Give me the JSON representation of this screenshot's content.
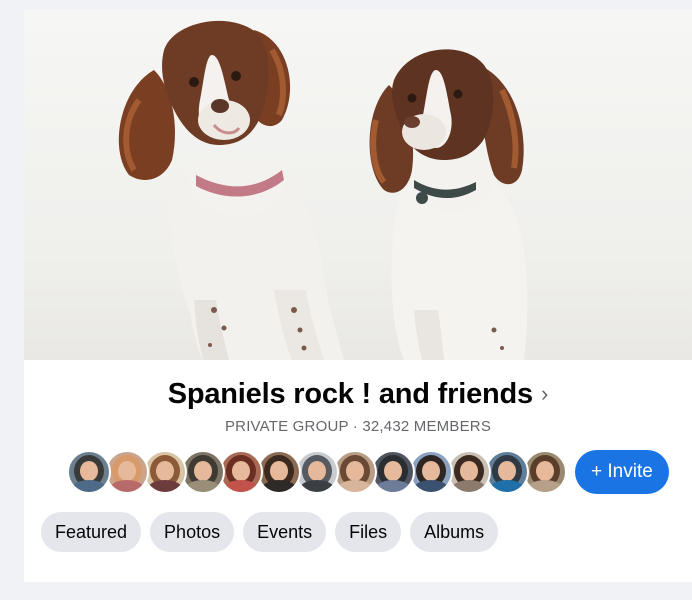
{
  "group": {
    "name": "Spaniels rock ! and friends",
    "chevron": "›",
    "subtitle": "PRIVATE GROUP · 32,432 MEMBERS"
  },
  "cover": {
    "description_icon": "cover-photo"
  },
  "members": {
    "avatars": [
      {
        "name": "member-avatar",
        "bg": "#6b7f8f",
        "hair": "#3a3a3a",
        "body": "#4d6a88"
      },
      {
        "name": "member-avatar",
        "bg": "#c9a58e",
        "hair": "#d89a6a",
        "body": "#b76a6a"
      },
      {
        "name": "member-avatar",
        "bg": "#d8c3a3",
        "hair": "#8c5a38",
        "body": "#6c3b3b"
      },
      {
        "name": "member-avatar",
        "bg": "#7c7564",
        "hair": "#3f3a33",
        "body": "#9a8e78"
      },
      {
        "name": "member-avatar",
        "bg": "#a86a54",
        "hair": "#6a2e22",
        "body": "#c2534a"
      },
      {
        "name": "member-avatar",
        "bg": "#8c6b54",
        "hair": "#3d2a1e",
        "body": "#2e2a28"
      },
      {
        "name": "member-avatar",
        "bg": "#c8ccd0",
        "hair": "#555b61",
        "body": "#3b3f44"
      },
      {
        "name": "member-avatar",
        "bg": "#b89c86",
        "hair": "#6a4a35",
        "body": "#d8b49a"
      },
      {
        "name": "member-avatar",
        "bg": "#4e5560",
        "hair": "#2a2d31",
        "body": "#6d7d99"
      },
      {
        "name": "member-avatar",
        "bg": "#8aa2c0",
        "hair": "#2d2622",
        "body": "#3a5170"
      },
      {
        "name": "member-avatar",
        "bg": "#c9c0b5",
        "hair": "#3c2a22",
        "body": "#8c7a6c"
      },
      {
        "name": "member-avatar",
        "bg": "#5f7f99",
        "hair": "#2f3a44",
        "body": "#1f6fa8"
      },
      {
        "name": "member-avatar",
        "bg": "#9a8a72",
        "hair": "#5a3e2a",
        "body": "#b7a08a"
      }
    ],
    "invite_label": "+ Invite"
  },
  "tabs": [
    {
      "label": "Featured"
    },
    {
      "label": "Photos"
    },
    {
      "label": "Events"
    },
    {
      "label": "Files"
    },
    {
      "label": "Albums"
    }
  ],
  "colors": {
    "accent": "#1b74e4",
    "tab_bg": "#e4e6eb",
    "page_bg": "#f0f2f5"
  }
}
